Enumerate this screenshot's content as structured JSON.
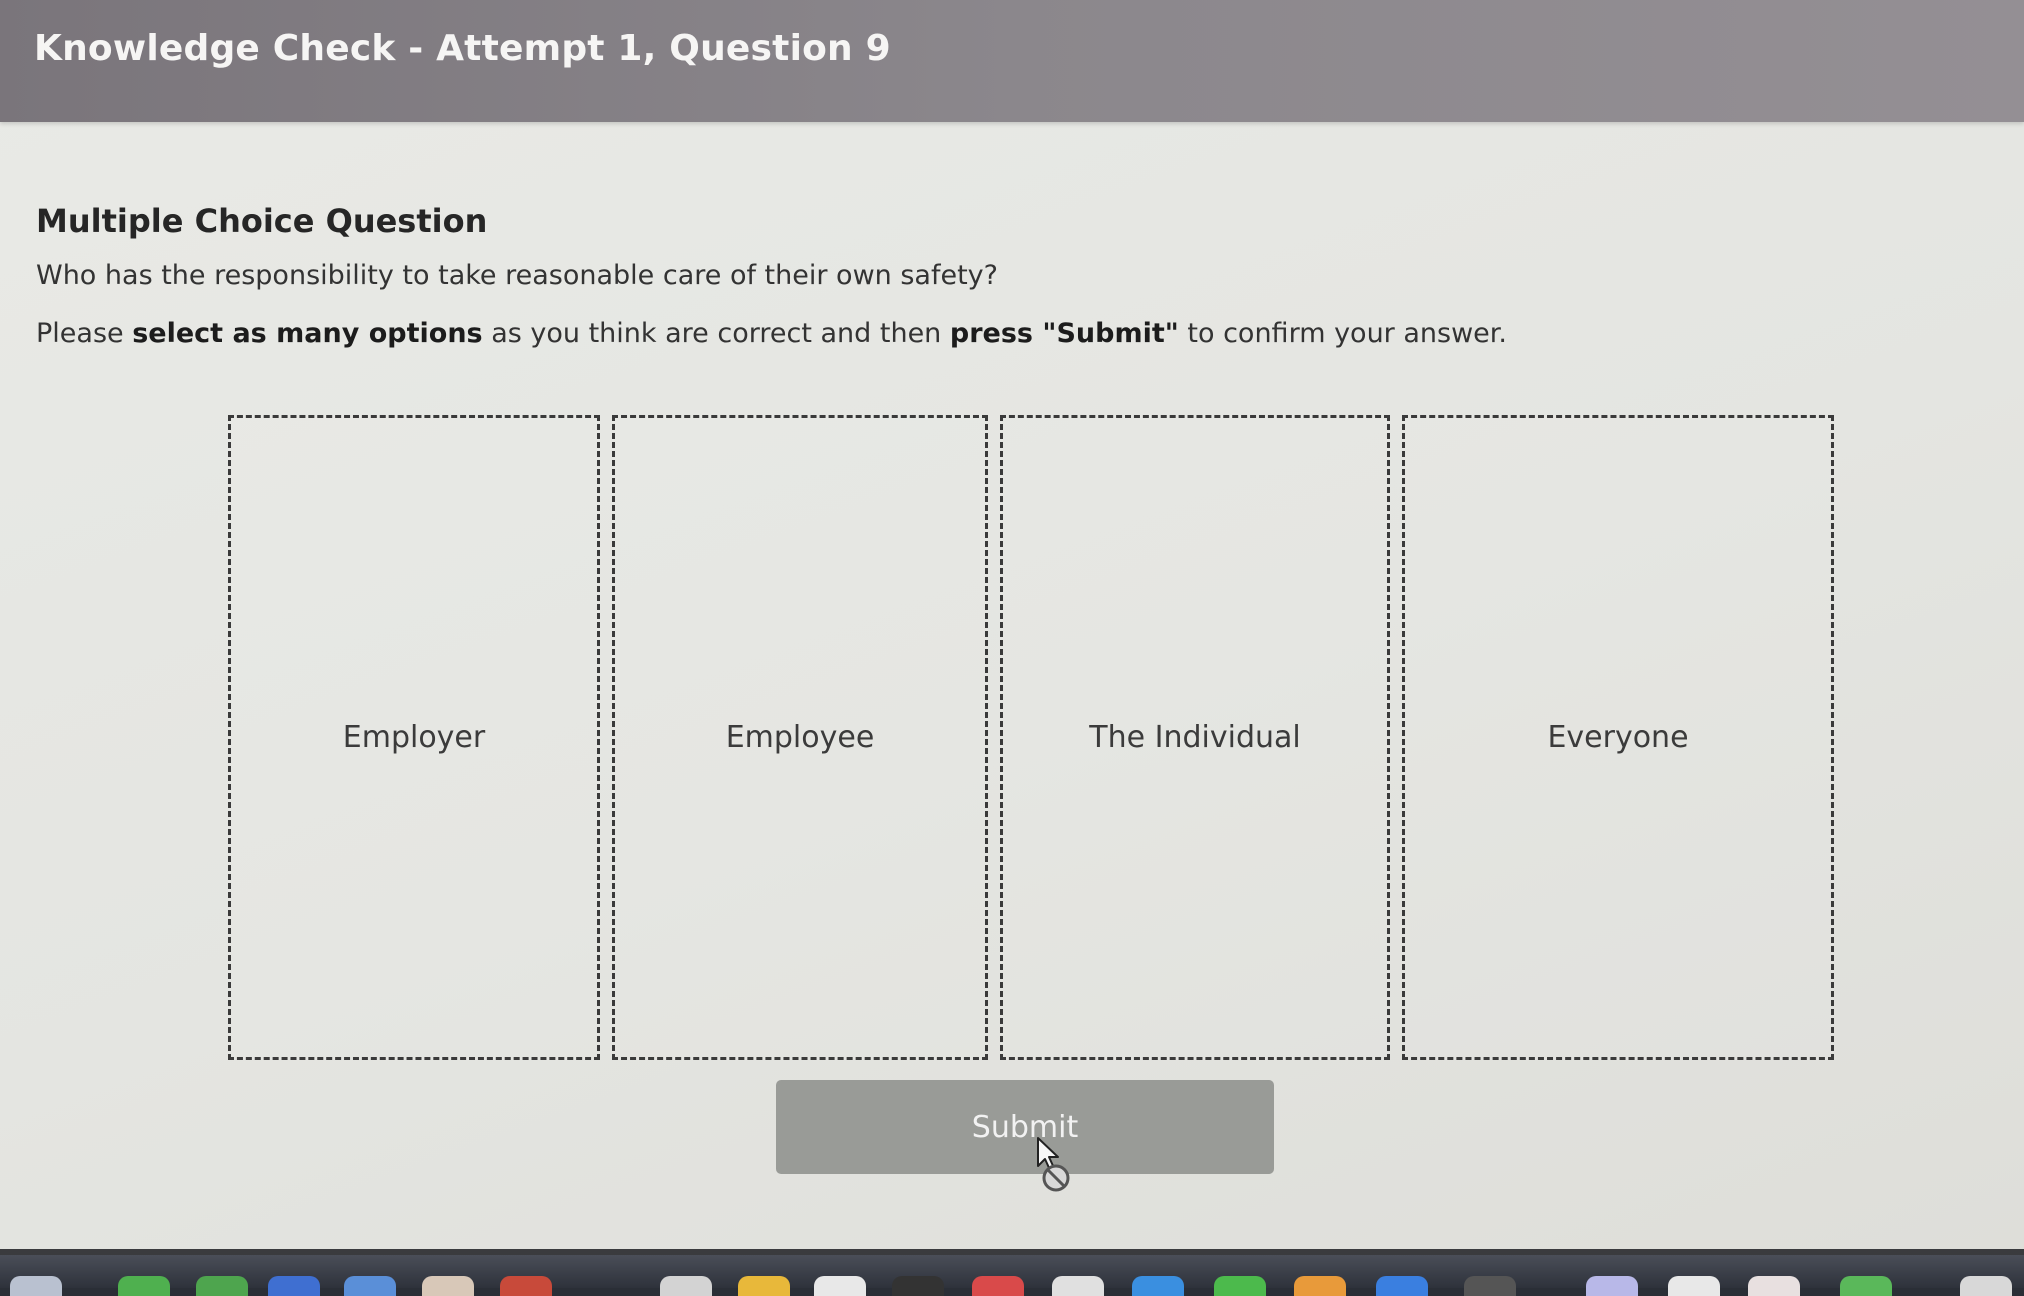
{
  "window": {
    "title": "Knowledge Check - Attempt 1, Question 9"
  },
  "question": {
    "type_heading": "Multiple Choice Question",
    "text": "Who has the responsibility to take reasonable care of their own safety?",
    "instruction": {
      "part1": "Please ",
      "bold1": "select as many options",
      "part2": " as you think are correct and then ",
      "bold2": "press \"Submit\"",
      "part3": " to confirm your answer."
    }
  },
  "options": [
    {
      "label": "Employer"
    },
    {
      "label": "Employee"
    },
    {
      "label": "The Individual"
    },
    {
      "label": "Everyone"
    }
  ],
  "submit": {
    "label": "Submit",
    "state": "disabled"
  },
  "colors": {
    "title_bar": "#8b878c",
    "content_bg": "#e6e7e3",
    "submit_bg": "#999b97",
    "option_border": "#3a3a3a"
  },
  "icons": {
    "cursor": "not-allowed-cursor-icon"
  }
}
